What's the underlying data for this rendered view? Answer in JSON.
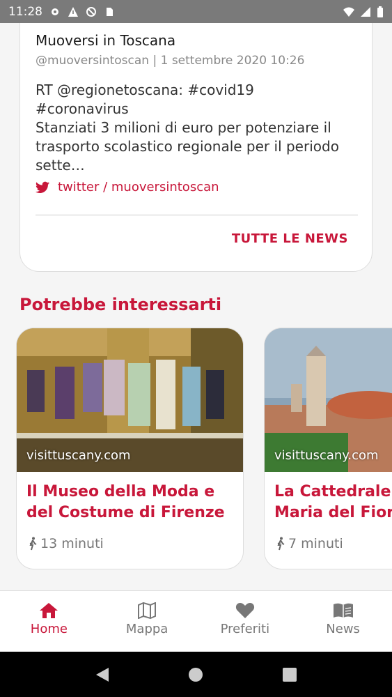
{
  "statusbar": {
    "time": "11:28"
  },
  "news": {
    "author": "Muoversi in Toscana",
    "meta": "@muoversintoscan | 1 settembre 2020 10:26",
    "text": "RT @regionetoscana: #covid19\n#coronavirus\nStanziati 3 milioni di euro per potenziare il trasporto scolastico regionale per il periodo sette…",
    "link": "twitter / muoversintoscan",
    "all_label": "TUTTE LE NEWS"
  },
  "section": {
    "title": "Potrebbe interessarti"
  },
  "poi": [
    {
      "credit": "visittuscany.com",
      "title_line1": "Il Museo della Moda e",
      "title_line2": "del Costume di Firenze",
      "time": "13 minuti"
    },
    {
      "credit": "visittuscany.com",
      "title_line1": "La Cattedrale di Santa",
      "title_line2": "Maria del Fiore",
      "time": "7 minuti"
    }
  ],
  "nav": [
    {
      "label": "Home",
      "icon": "home-icon",
      "active": true
    },
    {
      "label": "Mappa",
      "icon": "map-icon"
    },
    {
      "label": "Preferiti",
      "icon": "heart-icon"
    },
    {
      "label": "News",
      "icon": "book-icon"
    }
  ],
  "colors": {
    "accent": "#c8173a"
  }
}
